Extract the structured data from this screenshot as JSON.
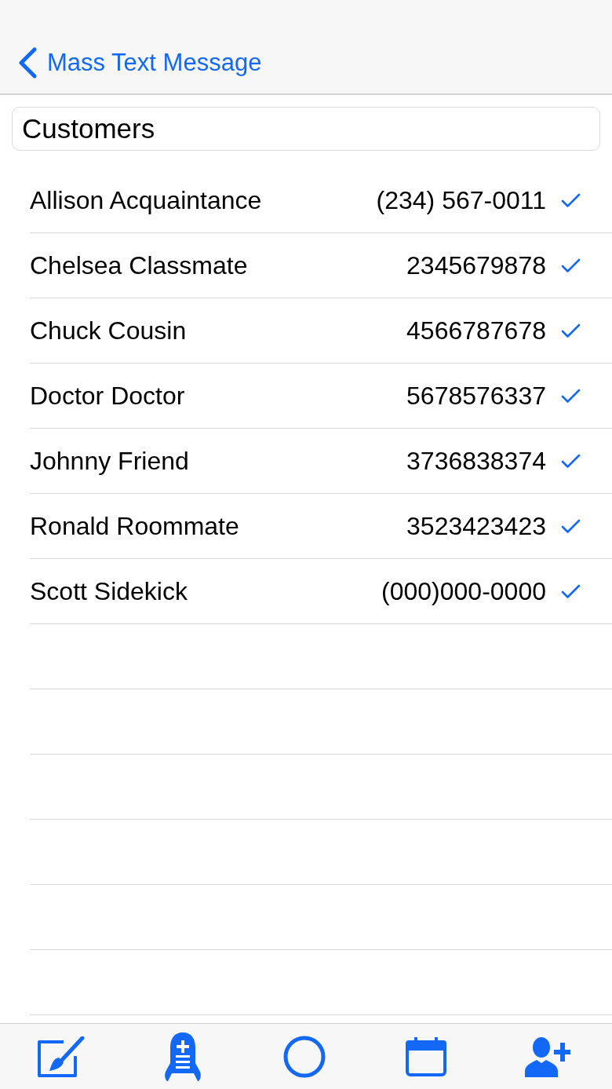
{
  "nav": {
    "back_label": "Mass Text Message"
  },
  "list_field": {
    "value": "Customers"
  },
  "contacts": [
    {
      "name": "Allison Acquaintance",
      "phone": "(234) 567-0011",
      "checked": true
    },
    {
      "name": "Chelsea Classmate",
      "phone": "2345679878",
      "checked": true
    },
    {
      "name": "Chuck Cousin",
      "phone": "4566787678",
      "checked": true
    },
    {
      "name": "Doctor Doctor",
      "phone": "5678576337",
      "checked": true
    },
    {
      "name": "Johnny Friend",
      "phone": "3736838374",
      "checked": true
    },
    {
      "name": "Ronald Roommate",
      "phone": "3523423423",
      "checked": true
    },
    {
      "name": "Scott Sidekick",
      "phone": "(000)000-0000",
      "checked": true
    }
  ]
}
